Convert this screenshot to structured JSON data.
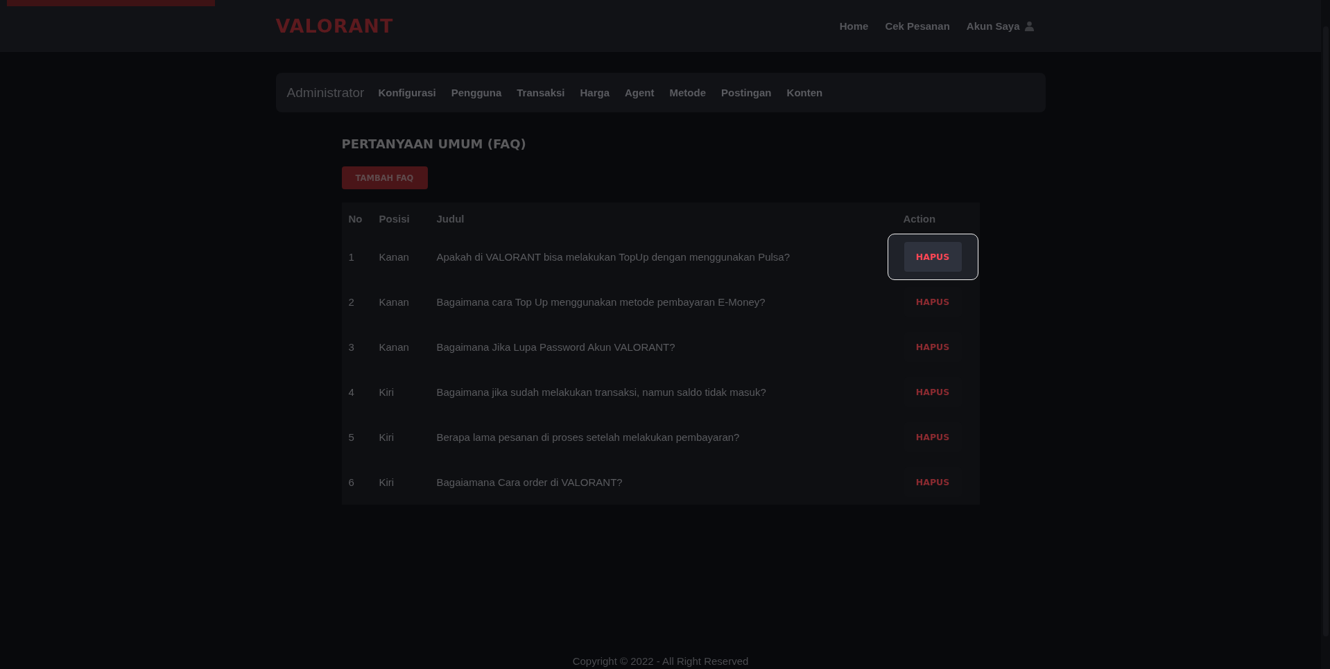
{
  "header": {
    "logo": "VALORANT",
    "nav": [
      {
        "label": "Home",
        "kind": "link"
      },
      {
        "label": "Cek Pesanan",
        "kind": "link"
      },
      {
        "label": "Akun Saya",
        "kind": "account"
      }
    ]
  },
  "admin_nav": {
    "title": "Administrator",
    "items": [
      "Konfigurasi",
      "Pengguna",
      "Transaksi",
      "Harga",
      "Agent",
      "Metode",
      "Postingan",
      "Konten"
    ]
  },
  "page_title": "PERTANYAAN UMUM (FAQ)",
  "add_button": "TAMBAH FAQ",
  "table": {
    "columns": [
      "No",
      "Posisi",
      "Judul",
      "Action"
    ],
    "rows": [
      {
        "no": "1",
        "posisi": "Kanan",
        "judul": "Apakah di VALORANT bisa melakukan TopUp dengan menggunakan Pulsa?",
        "action": "HAPUS",
        "highlighted": true
      },
      {
        "no": "2",
        "posisi": "Kanan",
        "judul": "Bagaimana cara Top Up menggunakan metode pembayaran E-Money?",
        "action": "HAPUS",
        "highlighted": false
      },
      {
        "no": "3",
        "posisi": "Kanan",
        "judul": "Bagaimana Jika Lupa Password Akun VALORANT?",
        "action": "HAPUS",
        "highlighted": false
      },
      {
        "no": "4",
        "posisi": "Kiri",
        "judul": "Bagaimana jika sudah melakukan transaksi, namun saldo tidak masuk?",
        "action": "HAPUS",
        "highlighted": false
      },
      {
        "no": "5",
        "posisi": "Kiri",
        "judul": "Berapa lama pesanan di proses setelah melakukan pembayaran?",
        "action": "HAPUS",
        "highlighted": false
      },
      {
        "no": "6",
        "posisi": "Kiri",
        "judul": "Bagaiamana Cara order di VALORANT?",
        "action": "HAPUS",
        "highlighted": false
      }
    ]
  },
  "footer": "Copyright © 2022 - All Right Reserved"
}
